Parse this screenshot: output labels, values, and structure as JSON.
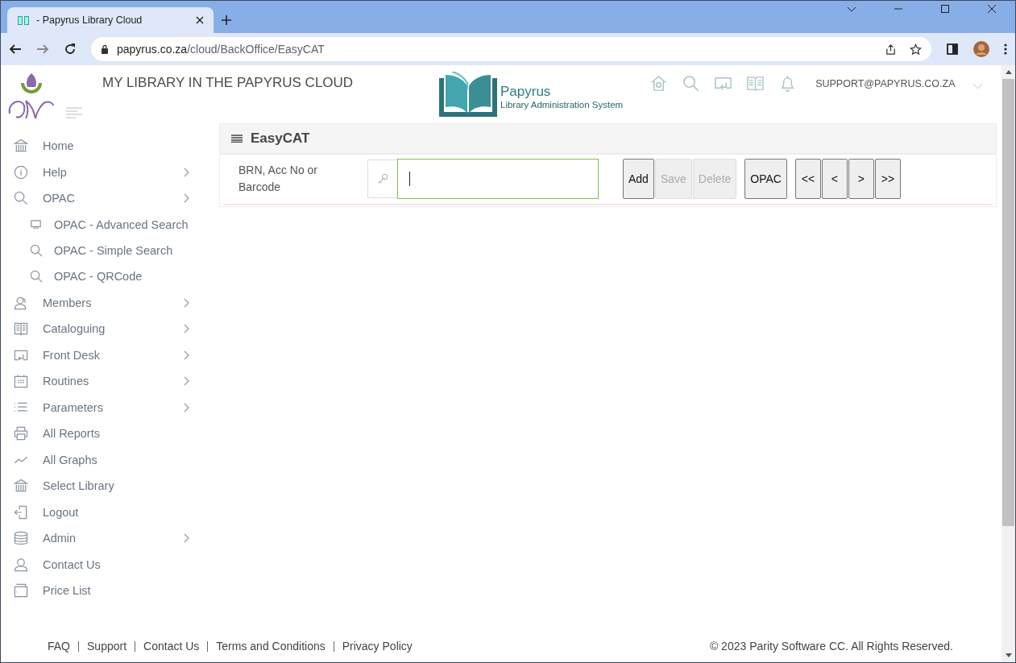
{
  "browser": {
    "tab_title": "- Papyrus Library Cloud",
    "url_host": "papyrus.co.za",
    "url_path": "/cloud/BackOffice/EasyCAT"
  },
  "header": {
    "site_title": "MY LIBRARY IN THE PAPYRUS CLOUD",
    "brand_name": "Papyrus",
    "brand_tagline": "Library Administration System",
    "user_email": "SUPPORT@PAPYRUS.CO.ZA"
  },
  "sidebar": {
    "items": [
      {
        "label": "Home",
        "submenu": false
      },
      {
        "label": "Help",
        "submenu": true
      },
      {
        "label": "OPAC",
        "submenu": true,
        "children": [
          {
            "label": "OPAC - Advanced Search"
          },
          {
            "label": "OPAC - Simple Search"
          },
          {
            "label": "OPAC - QRCode"
          }
        ]
      },
      {
        "label": "Members",
        "submenu": true
      },
      {
        "label": "Cataloguing",
        "submenu": true
      },
      {
        "label": "Front Desk",
        "submenu": true
      },
      {
        "label": "Routines",
        "submenu": true
      },
      {
        "label": "Parameters",
        "submenu": true
      },
      {
        "label": "All Reports",
        "submenu": false
      },
      {
        "label": "All Graphs",
        "submenu": false
      },
      {
        "label": "Select Library",
        "submenu": false
      },
      {
        "label": "Logout",
        "submenu": false
      },
      {
        "label": "Admin",
        "submenu": true
      },
      {
        "label": "Contact Us",
        "submenu": false
      },
      {
        "label": "Price List",
        "submenu": false
      }
    ]
  },
  "panel": {
    "title": "EasyCAT",
    "field_label": "BRN, Acc No or Barcode",
    "focused": true,
    "button_groups": [
      [
        {
          "label": "Add",
          "disabled": false
        },
        {
          "label": "Save",
          "disabled": true
        },
        {
          "label": "Delete",
          "disabled": true
        }
      ],
      [
        {
          "label": "OPAC",
          "disabled": false
        }
      ],
      [
        {
          "label": "<<",
          "disabled": false
        },
        {
          "label": "<",
          "disabled": false
        },
        {
          "label": ">",
          "disabled": false
        },
        {
          "label": ">>",
          "disabled": false
        }
      ]
    ]
  },
  "footer": {
    "links": [
      "FAQ",
      "Support",
      "Contact Us",
      "Terms and Conditions",
      "Privacy Policy"
    ],
    "copyright": "© 2023 Parity Software CC. All Rights Reserved."
  }
}
